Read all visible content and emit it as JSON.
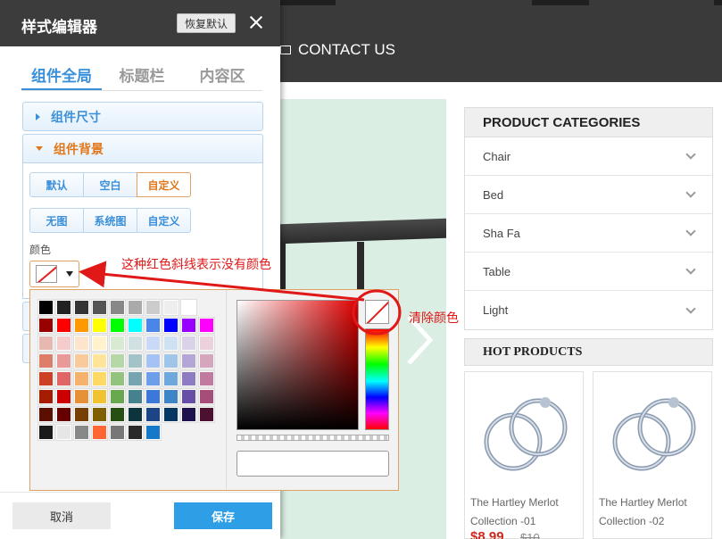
{
  "site": {
    "nav_contact": "CONTACT US",
    "categories": {
      "title": "PRODUCT CATEGORIES",
      "items": [
        "Chair",
        "Bed",
        "Sha Fa",
        "Table",
        "Light"
      ]
    },
    "hot_products": {
      "title": "HOT PRODUCTS",
      "items": [
        {
          "name": "The Hartley Merlot Collection -01",
          "price": "$8.99",
          "old_price": "$10"
        },
        {
          "name": "The Hartley Merlot Collection -02",
          "price": "",
          "old_price": ""
        }
      ]
    }
  },
  "editor": {
    "title": "样式编辑器",
    "reset_label": "恢复默认",
    "tabs": [
      {
        "label": "组件全局",
        "active": true
      },
      {
        "label": "标题栏",
        "active": false
      },
      {
        "label": "内容区",
        "active": false
      }
    ],
    "sections": {
      "size": "组件尺寸",
      "background": "组件背景"
    },
    "bg_mode": [
      "默认",
      "空白",
      "自定义"
    ],
    "bg_mode_active": 2,
    "bg_image": [
      "无图",
      "系统图",
      "自定义"
    ],
    "color_label": "颜色",
    "cancel_label": "取消",
    "save_label": "保存"
  },
  "picker": {
    "hex_value": "",
    "palette": [
      [
        "#000000",
        "#222222",
        "#333333",
        "#555555",
        "#888888",
        "#aaaaaa",
        "#cccccc",
        "#eeeeee",
        "#ffffff"
      ],
      [
        "#990000",
        "#ff0000",
        "#ff9900",
        "#ffff00",
        "#00ff00",
        "#00ffff",
        "#4a86e8",
        "#0000ff",
        "#9900ff",
        "#ff00ff"
      ],
      [
        "#e6b8af",
        "#f4cccc",
        "#fce5cd",
        "#fff2cc",
        "#d9ead3",
        "#d0e0e3",
        "#c9daf8",
        "#cfe2f3",
        "#d9d2e9",
        "#ead1dc"
      ],
      [
        "#dd7e6b",
        "#ea9999",
        "#f9cb9c",
        "#ffe599",
        "#b6d7a8",
        "#a2c4c9",
        "#a4c2f4",
        "#9fc5e8",
        "#b4a7d6",
        "#d5a6bd"
      ],
      [
        "#cc4125",
        "#e06666",
        "#f6b26b",
        "#ffd966",
        "#93c47d",
        "#76a5af",
        "#6d9eeb",
        "#6fa8dc",
        "#8e7cc3",
        "#c27ba0"
      ],
      [
        "#a61c00",
        "#cc0000",
        "#e69138",
        "#f1c232",
        "#6aa84f",
        "#45818e",
        "#3c78d8",
        "#3d85c6",
        "#674ea7",
        "#a64d79"
      ],
      [
        "#5b0f00",
        "#660000",
        "#783f04",
        "#7f6000",
        "#274e13",
        "#0c343d",
        "#1c4587",
        "#073763",
        "#20124d",
        "#4c1130"
      ],
      [
        "#1a1a1a",
        "#e6e6e6",
        "#888888",
        "#ff6633",
        "#777777",
        "#2a2a2a",
        "#1479c8"
      ]
    ]
  },
  "annotations": {
    "no_color_note": "这种红色斜线表示没有颜色",
    "clear_color_note": "清除颜色"
  },
  "colors": {
    "accent": "#3a8fd9",
    "active": "#e0771a",
    "save": "#2e9ee6",
    "annotation": "#e01818"
  }
}
